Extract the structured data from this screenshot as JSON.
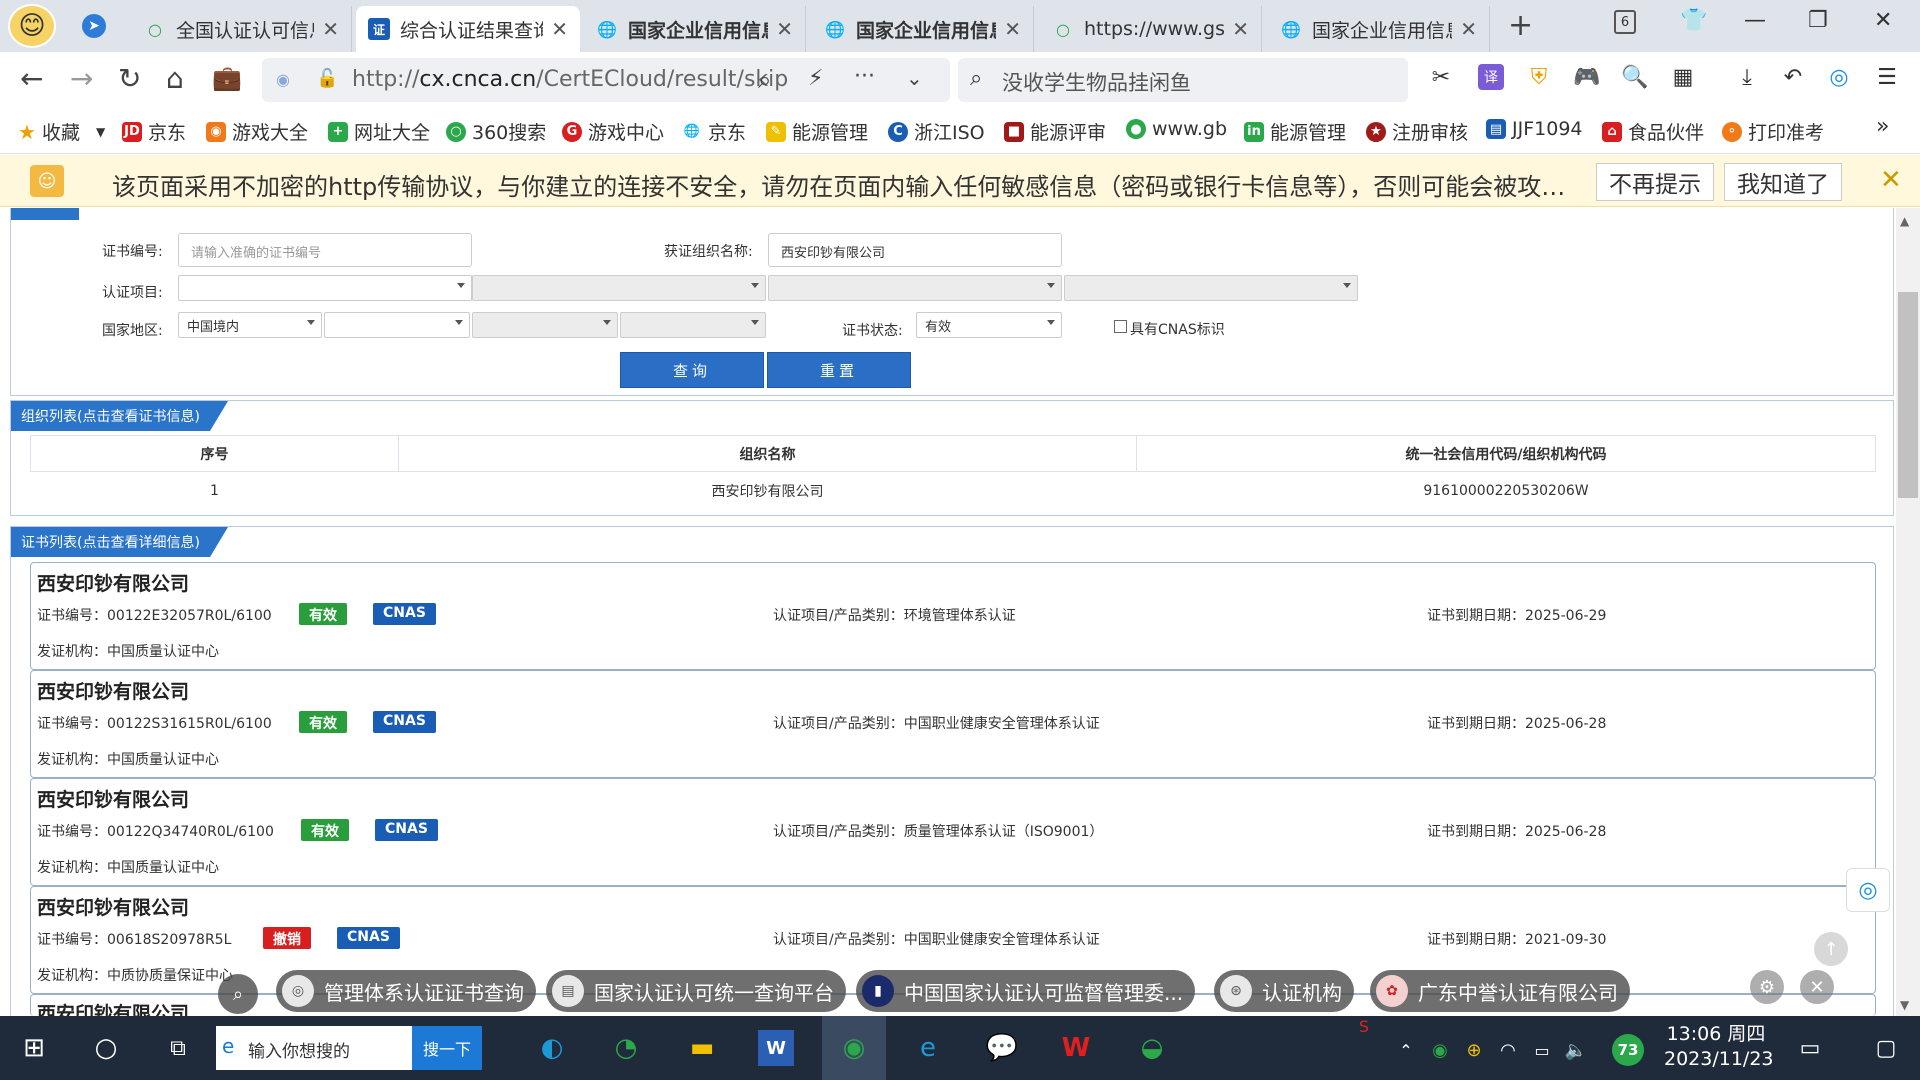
{
  "browser": {
    "tabs": [
      {
        "title": "全国认证认可信息"
      },
      {
        "title": "综合认证结果查询"
      },
      {
        "title": "国家企业信用信息"
      },
      {
        "title": "国家企业信用信息"
      },
      {
        "title": "https://www.gsx"
      },
      {
        "title": "国家企业信用信息"
      }
    ],
    "tab_count": "6",
    "url_prefix": "http://",
    "url_domain": "cx.cnca.cn",
    "url_path": "/CertECloud/result/skip",
    "search_text": "没收学生物品挂闲鱼",
    "bookmarks": [
      "收藏",
      "京东",
      "游戏大全",
      "网址大全",
      "360搜索",
      "游戏中心",
      "京东",
      "能源管理",
      "浙江ISO",
      "能源评审",
      "www.gb",
      "能源管理",
      "注册审核",
      "JJF1094",
      "食品伙伴",
      "打印准考"
    ],
    "warning_text": "该页面采用不加密的http传输协议，与你建立的连接不安全，请勿在页面内输入任何敏感信息（密码或银行卡信息等），否则可能会被攻…",
    "warning_btn_never": "不再提示",
    "warning_btn_ok": "我知道了"
  },
  "query": {
    "cert_no_label": "证书编号:",
    "cert_no_placeholder": "请输入准确的证书编号",
    "org_label": "获证组织名称:",
    "org_value": "西安印钞有限公司",
    "item_label": "认证项目:",
    "region_label": "国家地区:",
    "region_value": "中国境内",
    "status_label": "证书状态:",
    "status_value": "有效",
    "cnas_label": "具有CNAS标识",
    "query_btn": "查询",
    "reset_btn": "重置"
  },
  "org_list": {
    "title": "组织列表(点击查看证书信息)",
    "headers": [
      "序号",
      "组织名称",
      "统一社会信用代码/组织机构代码"
    ],
    "rows": [
      [
        "1",
        "西安印钞有限公司",
        "91610000220530206W"
      ]
    ]
  },
  "cert_list": {
    "title": "证书列表(点击查看详细信息)",
    "items": [
      {
        "name": "西安印钞有限公司",
        "cert_no": "证书编号：00122E32057R0L/6100",
        "status": "有效",
        "cnas": "CNAS",
        "item": "认证项目/产品类别：环境管理体系认证",
        "expiry": "证书到期日期：2025-06-29",
        "org": "发证机构：中国质量认证中心"
      },
      {
        "name": "西安印钞有限公司",
        "cert_no": "证书编号：00122S31615R0L/6100",
        "status": "有效",
        "cnas": "CNAS",
        "item": "认证项目/产品类别：中国职业健康安全管理体系认证",
        "expiry": "证书到期日期：2025-06-28",
        "org": "发证机构：中国质量认证中心"
      },
      {
        "name": "西安印钞有限公司",
        "cert_no": "证书编号：00122Q34740R0L/6100",
        "status": "有效",
        "cnas": "CNAS",
        "item": "认证项目/产品类别：质量管理体系认证（ISO9001）",
        "expiry": "证书到期日期：2025-06-28",
        "org": "发证机构：中国质量认证中心"
      },
      {
        "name": "西安印钞有限公司",
        "cert_no": "证书编号：00618S20978R5L",
        "status": "撤销",
        "cnas": "CNAS",
        "item": "认证项目/产品类别：中国职业健康安全管理体系认证",
        "expiry": "证书到期日期：2021-09-30",
        "org": "发证机构：中质协质量保证中心"
      },
      {
        "name": "西安印钞有限公司"
      }
    ]
  },
  "floating_chips": [
    "管理体系认证证书查询",
    "国家认证认可统一查询平台",
    "中国国家认证认可监督管理委...",
    "认证机构",
    "广东中誉认证有限公司"
  ],
  "taskbar": {
    "search_placeholder": "输入你想搜的",
    "search_btn": "搜一下",
    "time": "13:06 周四",
    "date": "2023/11/23",
    "battery": "73"
  }
}
